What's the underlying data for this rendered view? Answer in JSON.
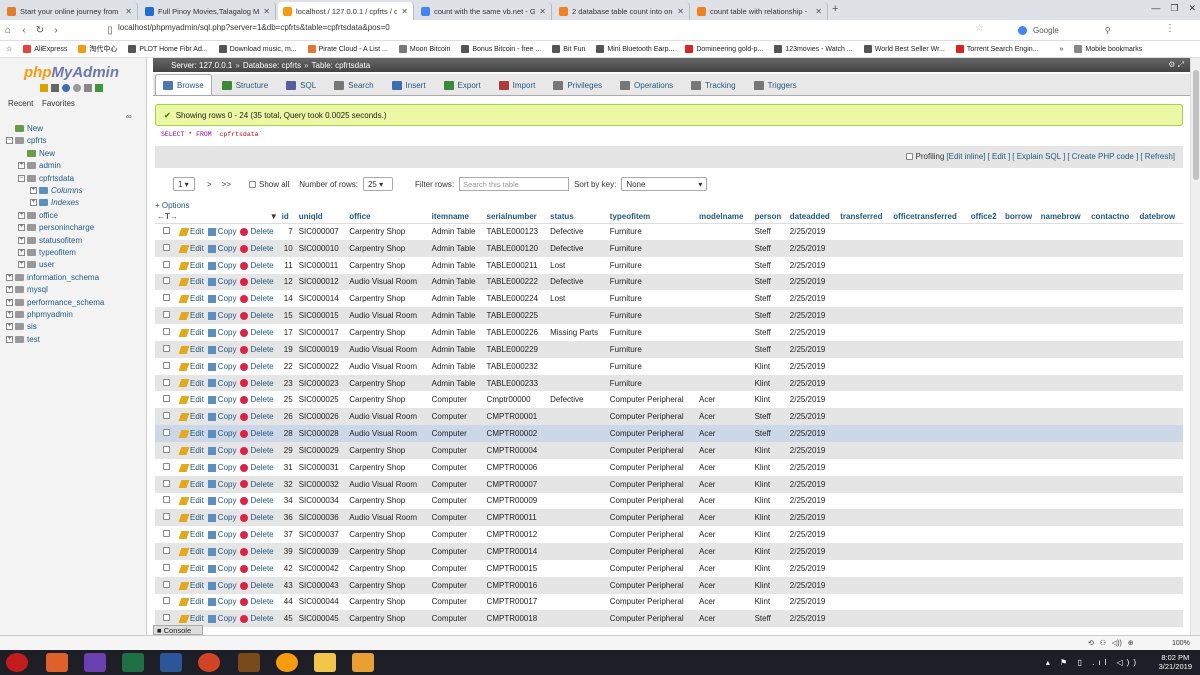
{
  "tabs": [
    {
      "title": "Start your online journey from",
      "color": "#e37c2b",
      "active": false
    },
    {
      "title": "Full Pinoy Movies,Talagalog M",
      "color": "#1f6fd1",
      "active": false
    },
    {
      "title": "localhost / 127.0.0.1 / cpfrts / c",
      "color": "#f89c0e",
      "active": true
    },
    {
      "title": "count with the same vb.net - G",
      "color": "#4285f4",
      "active": false
    },
    {
      "title": "2 database table count into on",
      "color": "#f48024",
      "active": false
    },
    {
      "title": "count table with relationship -",
      "color": "#f48024",
      "active": false
    }
  ],
  "url": "localhost/phpmyadmin/sql.php?server=1&db=cpfrts&table=cpfrtsdata&pos=0",
  "search_engine": "Google",
  "bookmarks": [
    "AliExpress",
    "淘代中心",
    "PLDT Home Fibr Ad...",
    "Download music, m...",
    "Pirate Cloud - A List ...",
    "Moon Bitcoin",
    "Bonus Bitcoin - free ...",
    "Bit Fun",
    "Mini Bluetooth Earp...",
    "Domineering gold-p...",
    "123movies - Watch ...",
    "World Best Seller Wr...",
    "Torrent Search Engin..."
  ],
  "bookmarks_more": "»",
  "mobile_bookmarks": "Mobile bookmarks",
  "pma": {
    "logo_php": "php",
    "logo_myadmin": "MyAdmin",
    "recent": "Recent",
    "favorites": "Favorites",
    "tree": [
      {
        "label": "New",
        "level": 0,
        "sign": ""
      },
      {
        "label": "cpfrts",
        "level": 0,
        "sign": "−"
      },
      {
        "label": "New",
        "level": 1,
        "sign": ""
      },
      {
        "label": "admin",
        "level": 1,
        "sign": "+"
      },
      {
        "label": "cpfrtsdata",
        "level": 1,
        "sign": "−"
      },
      {
        "label": "Columns",
        "level": 2,
        "sign": "+"
      },
      {
        "label": "Indexes",
        "level": 2,
        "sign": "+"
      },
      {
        "label": "office",
        "level": 1,
        "sign": "+"
      },
      {
        "label": "personincharge",
        "level": 1,
        "sign": "+"
      },
      {
        "label": "statusofitem",
        "level": 1,
        "sign": "+"
      },
      {
        "label": "typeofitem",
        "level": 1,
        "sign": "+"
      },
      {
        "label": "user",
        "level": 1,
        "sign": "+"
      },
      {
        "label": "information_schema",
        "level": 0,
        "sign": "+"
      },
      {
        "label": "mysql",
        "level": 0,
        "sign": "+"
      },
      {
        "label": "performance_schema",
        "level": 0,
        "sign": "+"
      },
      {
        "label": "phpmyadmin",
        "level": 0,
        "sign": "+"
      },
      {
        "label": "sis",
        "level": 0,
        "sign": "+"
      },
      {
        "label": "test",
        "level": 0,
        "sign": "+"
      }
    ]
  },
  "breadcrumb": {
    "server": "Server: 127.0.0.1",
    "database": "Database: cpfrts",
    "table": "Table: cpfrtsdata"
  },
  "menu_tabs": [
    "Browse",
    "Structure",
    "SQL",
    "Search",
    "Insert",
    "Export",
    "Import",
    "Privileges",
    "Operations",
    "Tracking",
    "Triggers"
  ],
  "success_msg": "Showing rows 0 - 24 (35 total, Query took 0.0025 seconds.)",
  "sql": {
    "select": "SELECT",
    "star": " * ",
    "from": "FROM",
    "table": " `cpfrtsdata`"
  },
  "profiling": {
    "label": "Profiling",
    "links": [
      "[Edit inline]",
      "[ Edit ]",
      "[ Explain SQL ]",
      "[ Create PHP code ]",
      "[ Refresh]"
    ]
  },
  "nav": {
    "page": "1",
    "next": ">",
    "last": ">>",
    "show_all": "Show all",
    "rows_label": "Number of rows:",
    "rows": "25",
    "filter_label": "Filter rows:",
    "filter_placeholder": "Search this table",
    "sort_label": "Sort by key:",
    "sort": "None"
  },
  "options": "+ Options",
  "actions": {
    "edit": "Edit",
    "copy": "Copy",
    "delete": "Delete"
  },
  "columns": [
    "id",
    "uniqId",
    "office",
    "itemname",
    "serialnumber",
    "status",
    "typeofitem",
    "modelname",
    "person",
    "dateadded",
    "transferred",
    "officetransferred",
    "office2",
    "borrow",
    "namebrow",
    "contactno",
    "datebrow"
  ],
  "rows": [
    [
      "7",
      "SIC000007",
      "Carpentry Shop",
      "Admin Table",
      "TABLE000123",
      "Defective",
      "Furniture",
      "",
      "Steff",
      "2/25/2019"
    ],
    [
      "10",
      "SIC000010",
      "Carpentry Shop",
      "Admin Table",
      "TABLE000120",
      "Defective",
      "Furniture",
      "",
      "Steff",
      "2/25/2019"
    ],
    [
      "11",
      "SIC000011",
      "Carpentry Shop",
      "Admin Table",
      "TABLE000211",
      "Lost",
      "Furniture",
      "",
      "Steff",
      "2/25/2019"
    ],
    [
      "12",
      "SIC000012",
      "Audio Visual Room",
      "Admin Table",
      "TABLE000222",
      "Defective",
      "Furniture",
      "",
      "Steff",
      "2/25/2019"
    ],
    [
      "14",
      "SIC000014",
      "Carpentry Shop",
      "Admin Table",
      "TABLE000224",
      "Lost",
      "Furniture",
      "",
      "Steff",
      "2/25/2019"
    ],
    [
      "15",
      "SIC000015",
      "Audio Visual Room",
      "Admin Table",
      "TABLE000225",
      "",
      "Furniture",
      "",
      "Steff",
      "2/25/2019"
    ],
    [
      "17",
      "SIC000017",
      "Carpentry Shop",
      "Admin Table",
      "TABLE000226",
      "Missing Parts",
      "Furniture",
      "",
      "Steff",
      "2/25/2019"
    ],
    [
      "19",
      "SIC000019",
      "Audio Visual Room",
      "Admin Table",
      "TABLE000229",
      "",
      "Furniture",
      "",
      "Steff",
      "2/25/2019"
    ],
    [
      "22",
      "SIC000022",
      "Audio Visual Room",
      "Admin Table",
      "TABLE000232",
      "",
      "Furniture",
      "",
      "Klint",
      "2/25/2019"
    ],
    [
      "23",
      "SIC000023",
      "Carpentry Shop",
      "Admin Table",
      "TABLE000233",
      "",
      "Furniture",
      "",
      "Klint",
      "2/25/2019"
    ],
    [
      "25",
      "SIC000025",
      "Carpentry Shop",
      "Computer",
      "Cmptr00000",
      "Defective",
      "Computer Peripheral",
      "Acer",
      "Klint",
      "2/25/2019"
    ],
    [
      "26",
      "SIC000026",
      "Audio Visual Room",
      "Computer",
      "CMPTR00001",
      "",
      "Computer Peripheral",
      "Acer",
      "Steff",
      "2/25/2019"
    ],
    [
      "28",
      "SIC000028",
      "Audio Visual Room",
      "Computer",
      "CMPTR00002",
      "",
      "Computer Peripheral",
      "Acer",
      "Steff",
      "2/25/2019"
    ],
    [
      "29",
      "SIC000029",
      "Carpentry Shop",
      "Computer",
      "CMPTR00004",
      "",
      "Computer Peripheral",
      "Acer",
      "Klint",
      "2/25/2019"
    ],
    [
      "31",
      "SIC000031",
      "Carpentry Shop",
      "Computer",
      "CMPTR00006",
      "",
      "Computer Peripheral",
      "Acer",
      "Klint",
      "2/25/2019"
    ],
    [
      "32",
      "SIC000032",
      "Audio Visual Room",
      "Computer",
      "CMPTR00007",
      "",
      "Computer Peripheral",
      "Acer",
      "Klint",
      "2/25/2019"
    ],
    [
      "34",
      "SIC000034",
      "Carpentry Shop",
      "Computer",
      "CMPTR00009",
      "",
      "Computer Peripheral",
      "Acer",
      "Klint",
      "2/25/2019"
    ],
    [
      "36",
      "SIC000036",
      "Audio Visual Room",
      "Computer",
      "CMPTR00011",
      "",
      "Computer Peripheral",
      "Acer",
      "Klint",
      "2/25/2019"
    ],
    [
      "37",
      "SIC000037",
      "Carpentry Shop",
      "Computer",
      "CMPTR00012",
      "",
      "Computer Peripheral",
      "Acer",
      "Klint",
      "2/25/2019"
    ],
    [
      "39",
      "SIC000039",
      "Carpentry Shop",
      "Computer",
      "CMPTR00014",
      "",
      "Computer Peripheral",
      "Acer",
      "Klint",
      "2/25/2019"
    ],
    [
      "42",
      "SIC000042",
      "Carpentry Shop",
      "Computer",
      "CMPTR00015",
      "",
      "Computer Peripheral",
      "Acer",
      "Klint",
      "2/25/2019"
    ],
    [
      "43",
      "SIC000043",
      "Carpentry Shop",
      "Computer",
      "CMPTR00016",
      "",
      "Computer Peripheral",
      "Acer",
      "Klint",
      "2/25/2019"
    ],
    [
      "44",
      "SIC000044",
      "Carpentry Shop",
      "Computer",
      "CMPTR00017",
      "",
      "Computer Peripheral",
      "Acer",
      "Klint",
      "2/25/2019"
    ],
    [
      "45",
      "SIC000045",
      "Carpentry Shop",
      "Computer",
      "CMPTR00018",
      "",
      "Computer Peripheral",
      "Acer",
      "Steff",
      "2/25/2019"
    ]
  ],
  "highlight_row": 12,
  "console": "Console",
  "zoom": "100%",
  "clock_time": "8:02 PM",
  "clock_date": "3/21/2019",
  "colors": {
    "pma_link": "#235a81",
    "success_bg": "#ebf8a4",
    "row_alt": "#e5e5e5",
    "row_hover": "#ccd8e8",
    "topnav": "#555555"
  }
}
